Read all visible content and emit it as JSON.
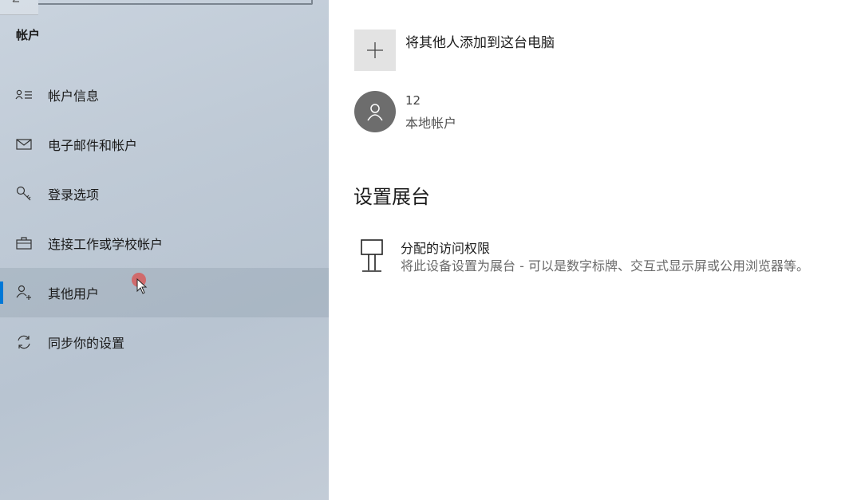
{
  "sidebar": {
    "section_title": "帐户",
    "items": [
      {
        "label": "帐户信息",
        "icon": "account-info-icon"
      },
      {
        "label": "电子邮件和帐户",
        "icon": "mail-icon"
      },
      {
        "label": "登录选项",
        "icon": "key-icon"
      },
      {
        "label": "连接工作或学校帐户",
        "icon": "briefcase-icon"
      },
      {
        "label": "其他用户",
        "icon": "add-person-icon",
        "active": true
      },
      {
        "label": "同步你的设置",
        "icon": "sync-icon"
      }
    ]
  },
  "main": {
    "add_other": {
      "label": "将其他人添加到这台电脑",
      "icon": "plus-icon"
    },
    "user": {
      "name": "12",
      "type": "本地帐户",
      "icon": "person-icon"
    },
    "kiosk": {
      "title": "设置展台",
      "item_title": "分配的访问权限",
      "item_desc": "将此设备设置为展台 - 可以是数字标牌、交互式显示屏或公用浏览器等。",
      "icon": "kiosk-icon"
    }
  },
  "colors": {
    "accent": "#0078d7",
    "sidebar_bg": "#c2ccd8",
    "avatar_bg": "#6d6d6d"
  }
}
